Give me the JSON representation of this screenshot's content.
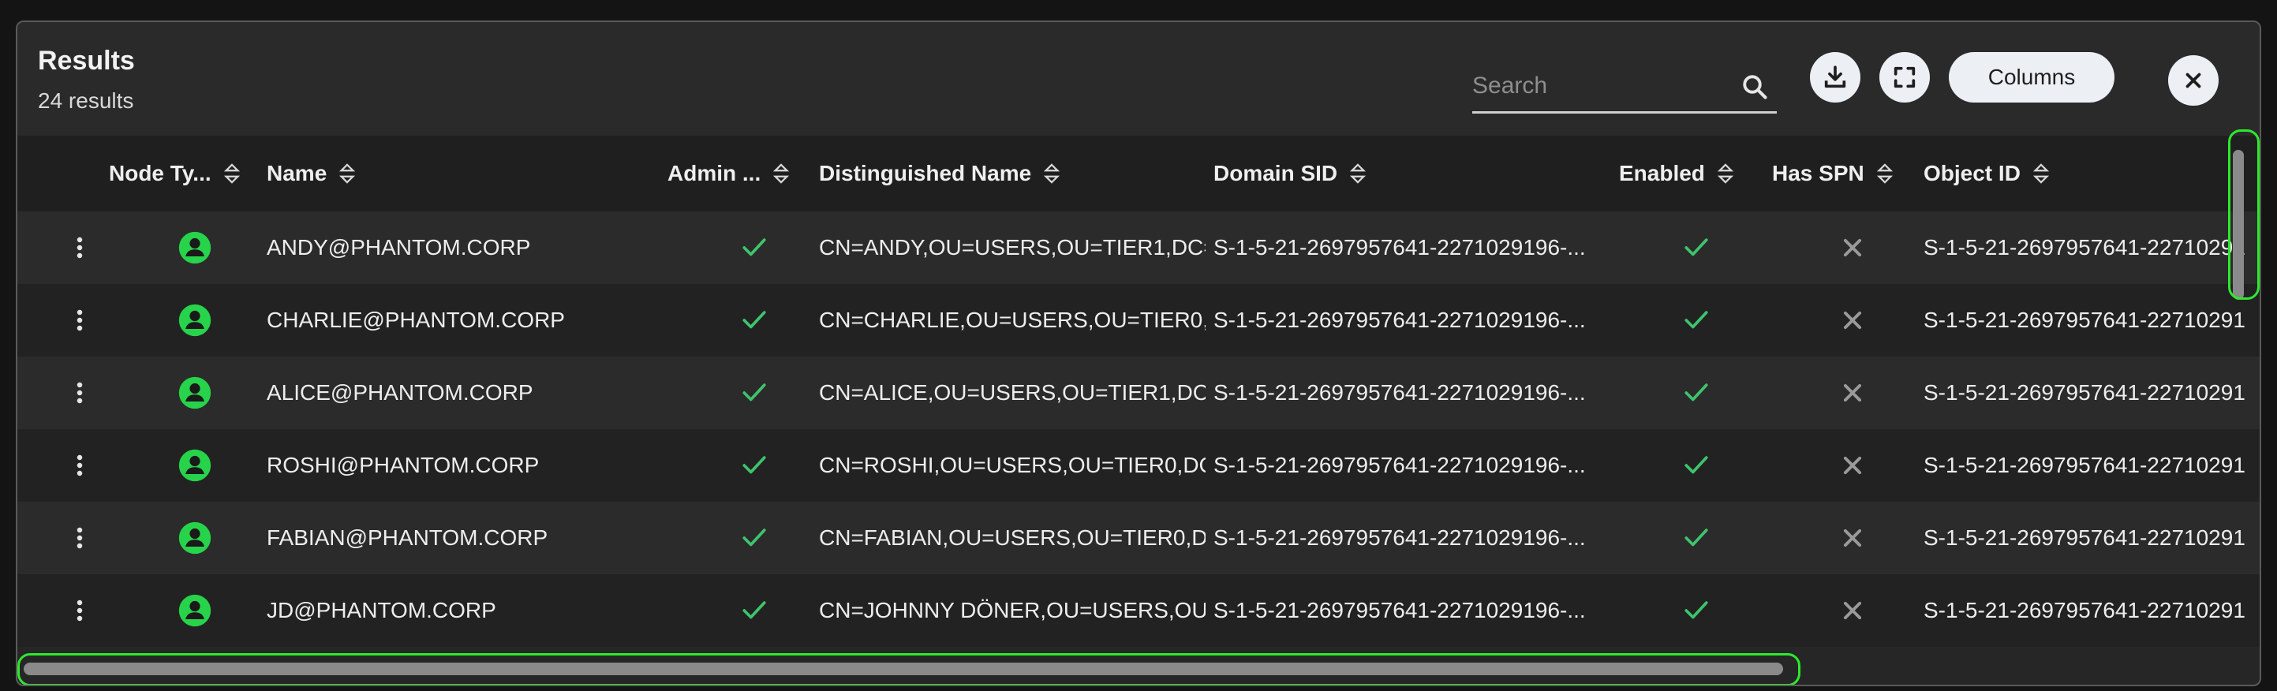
{
  "header": {
    "title": "Results",
    "count": "24 results",
    "search_placeholder": "Search",
    "columns_label": "Columns"
  },
  "columns": [
    {
      "key": "node_type",
      "label": "Node Ty..."
    },
    {
      "key": "name",
      "label": "Name"
    },
    {
      "key": "admin",
      "label": "Admin ..."
    },
    {
      "key": "dn",
      "label": "Distinguished Name"
    },
    {
      "key": "sid",
      "label": "Domain SID"
    },
    {
      "key": "enabled",
      "label": "Enabled"
    },
    {
      "key": "spn",
      "label": "Has SPN"
    },
    {
      "key": "oid",
      "label": "Object ID"
    }
  ],
  "rows": [
    {
      "name": "ANDY@PHANTOM.CORP",
      "dn": "CN=ANDY,OU=USERS,OU=TIER1,DC=...",
      "sid": "S-1-5-21-2697957641-2271029196-...",
      "oid": "S-1-5-21-2697957641-22710291"
    },
    {
      "name": "CHARLIE@PHANTOM.CORP",
      "dn": "CN=CHARLIE,OU=USERS,OU=TIER0,...",
      "sid": "S-1-5-21-2697957641-2271029196-...",
      "oid": "S-1-5-21-2697957641-22710291"
    },
    {
      "name": "ALICE@PHANTOM.CORP",
      "dn": "CN=ALICE,OU=USERS,OU=TIER1,DC...",
      "sid": "S-1-5-21-2697957641-2271029196-...",
      "oid": "S-1-5-21-2697957641-22710291"
    },
    {
      "name": "ROSHI@PHANTOM.CORP",
      "dn": "CN=ROSHI,OU=USERS,OU=TIER0,DC...",
      "sid": "S-1-5-21-2697957641-2271029196-...",
      "oid": "S-1-5-21-2697957641-22710291"
    },
    {
      "name": "FABIAN@PHANTOM.CORP",
      "dn": "CN=FABIAN,OU=USERS,OU=TIER0,D...",
      "sid": "S-1-5-21-2697957641-2271029196-...",
      "oid": "S-1-5-21-2697957641-22710291"
    },
    {
      "name": "JD@PHANTOM.CORP",
      "dn": "CN=JOHNNY DÖNER,OU=USERS,OU...",
      "sid": "S-1-5-21-2697957641-2271029196-...",
      "oid": "S-1-5-21-2697957641-22710291"
    }
  ],
  "colors": {
    "accent_green": "#2ee82e",
    "check_green": "#3ec46d",
    "cross_gray": "#9a9a9a",
    "user_icon_green": "#27d34a"
  },
  "icons": {
    "row_menu": "kebab-menu-icon",
    "node_type": "user-icon",
    "admin_true": "check-icon",
    "enabled_true": "check-icon",
    "spn_false": "cross-icon"
  }
}
